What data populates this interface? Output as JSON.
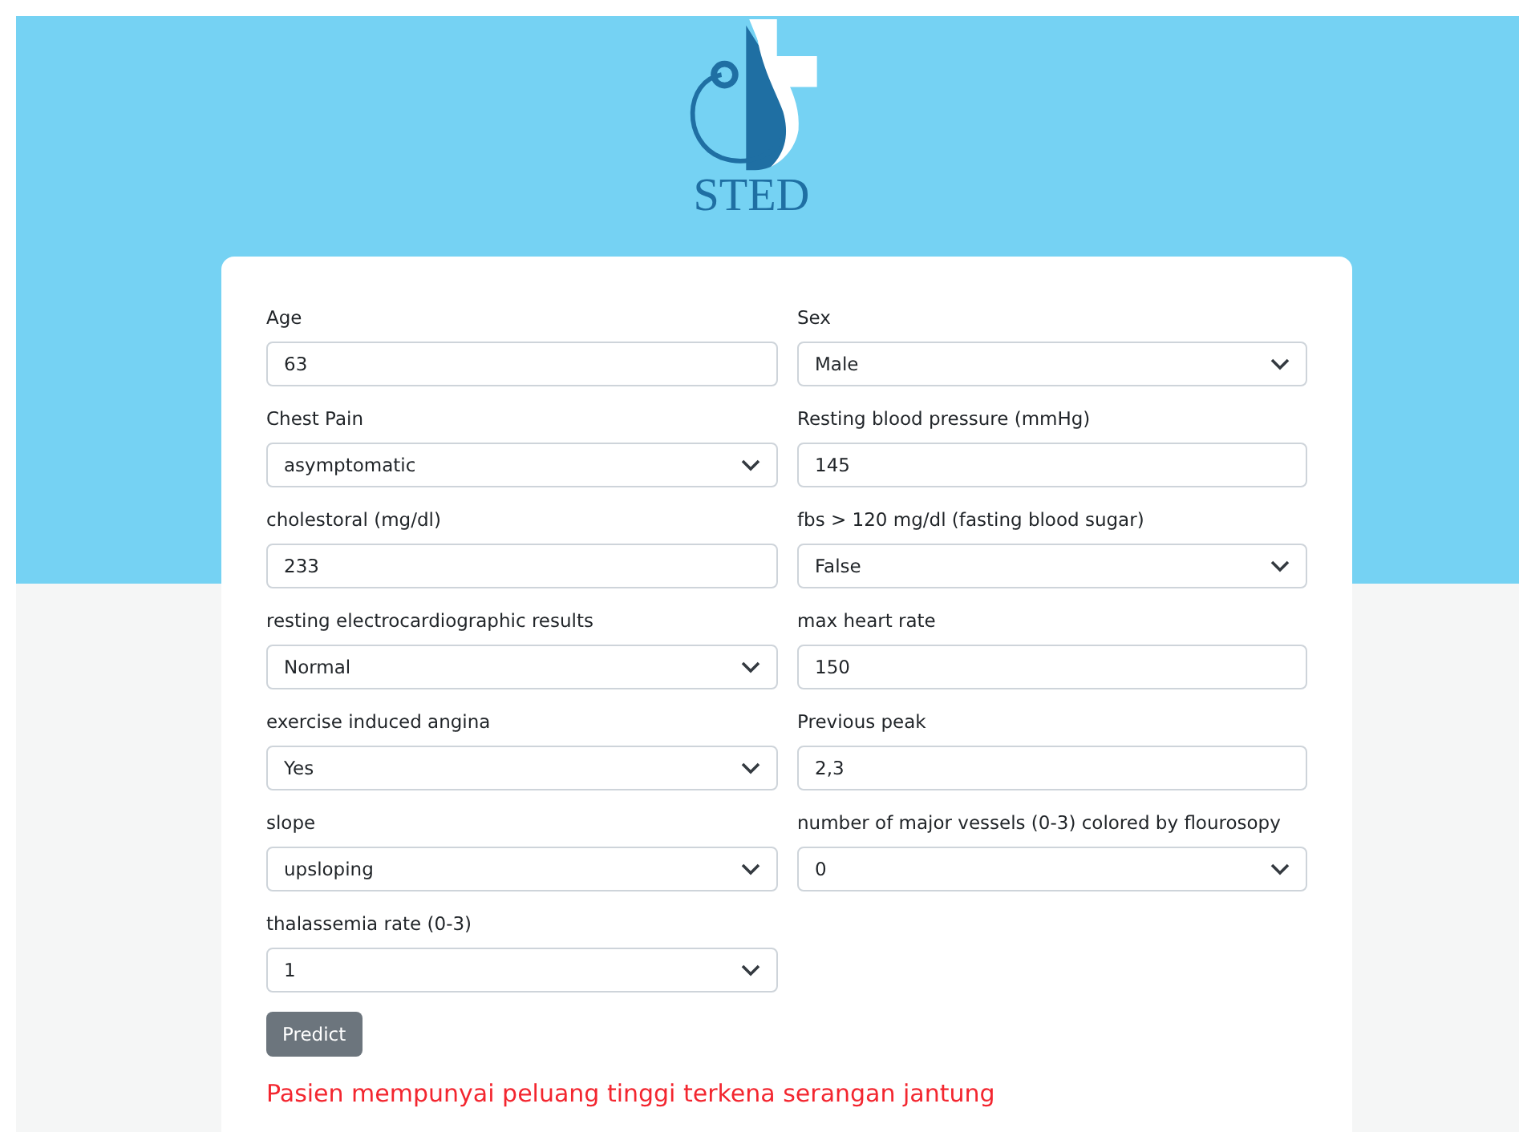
{
  "logo": {
    "text": "STED"
  },
  "fields": [
    {
      "label": "Age",
      "kind": "text",
      "value": "63"
    },
    {
      "label": "Sex",
      "kind": "select",
      "value": "Male"
    },
    {
      "label": "Chest Pain",
      "kind": "select",
      "value": "asymptomatic"
    },
    {
      "label": "Resting blood pressure (mmHg)",
      "kind": "text",
      "value": "145"
    },
    {
      "label": "cholestoral (mg/dl)",
      "kind": "text",
      "value": "233"
    },
    {
      "label": "fbs > 120 mg/dl (fasting blood sugar)",
      "kind": "select",
      "value": "False"
    },
    {
      "label": "resting electrocardiographic results",
      "kind": "select",
      "value": "Normal"
    },
    {
      "label": "max heart rate",
      "kind": "text",
      "value": "150"
    },
    {
      "label": "exercise induced angina",
      "kind": "select",
      "value": "Yes"
    },
    {
      "label": "Previous peak",
      "kind": "text",
      "value": "2,3"
    },
    {
      "label": "slope",
      "kind": "select",
      "value": "upsloping"
    },
    {
      "label": "number of major vessels (0-3) colored by flourosopy",
      "kind": "select",
      "value": "0"
    },
    {
      "label": "thalassemia rate (0-3)",
      "kind": "select",
      "value": "1"
    }
  ],
  "button": "Predict",
  "result": "Pasien mempunyai peluang tinggi terkena serangan jantung"
}
